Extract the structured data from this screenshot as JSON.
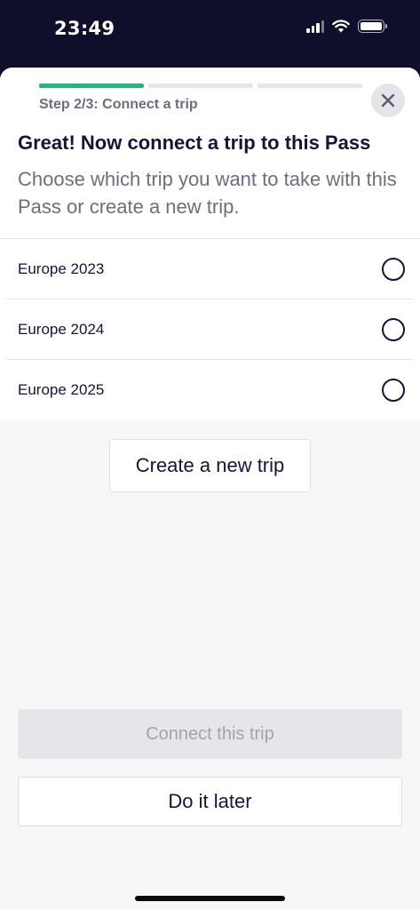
{
  "status_bar": {
    "time": "23:49",
    "icons": [
      "cellular-signal-icon",
      "wifi-icon",
      "battery-icon"
    ]
  },
  "progress": {
    "total_steps": 3,
    "current_step": 1,
    "step_label": "Step 2/3: Connect a trip",
    "active_color": "#27b37a"
  },
  "header": {
    "title": "Great! Now connect a trip to this Pass",
    "subtitle": "Choose which trip you want to take with this Pass or create a new trip.",
    "close_icon": "close-icon"
  },
  "trips": [
    {
      "label": "Europe 2023",
      "selected": false
    },
    {
      "label": "Europe 2024",
      "selected": false
    },
    {
      "label": "Europe 2025",
      "selected": false
    }
  ],
  "actions": {
    "create_label": "Create a new trip",
    "connect_label": "Connect this trip",
    "connect_enabled": false,
    "later_label": "Do it later"
  },
  "colors": {
    "status_bar_bg": "#0f0e2b",
    "text_primary": "#15143a",
    "text_secondary": "#6e6d80"
  }
}
